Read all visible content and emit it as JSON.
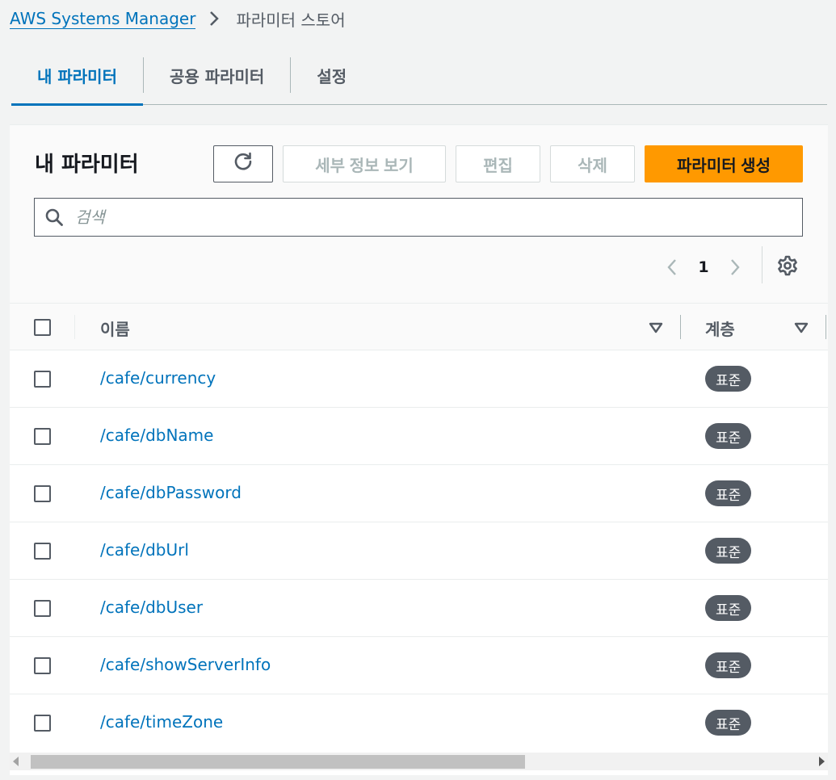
{
  "breadcrumb": {
    "parent": "AWS Systems Manager",
    "current": "파라미터 스토어"
  },
  "tabs": [
    {
      "label": "내 파라미터",
      "active": true
    },
    {
      "label": "공용 파라미터",
      "active": false
    },
    {
      "label": "설정",
      "active": false
    }
  ],
  "panel": {
    "title": "내 파라미터",
    "buttons": {
      "view_details": "세부 정보 보기",
      "edit": "편집",
      "delete": "삭제",
      "create": "파라미터 생성"
    },
    "search_placeholder": "검색",
    "pagination": {
      "current_page": "1"
    }
  },
  "table": {
    "columns": [
      "이름",
      "계층"
    ],
    "rows": [
      {
        "name": "/cafe/currency",
        "tier": "표준"
      },
      {
        "name": "/cafe/dbName",
        "tier": "표준"
      },
      {
        "name": "/cafe/dbPassword",
        "tier": "표준"
      },
      {
        "name": "/cafe/dbUrl",
        "tier": "표준"
      },
      {
        "name": "/cafe/dbUser",
        "tier": "표준"
      },
      {
        "name": "/cafe/showServerInfo",
        "tier": "표준"
      },
      {
        "name": "/cafe/timeZone",
        "tier": "표준"
      }
    ]
  },
  "colors": {
    "link": "#0073bb",
    "primary_button": "#ff9900",
    "badge": "#545b64"
  }
}
